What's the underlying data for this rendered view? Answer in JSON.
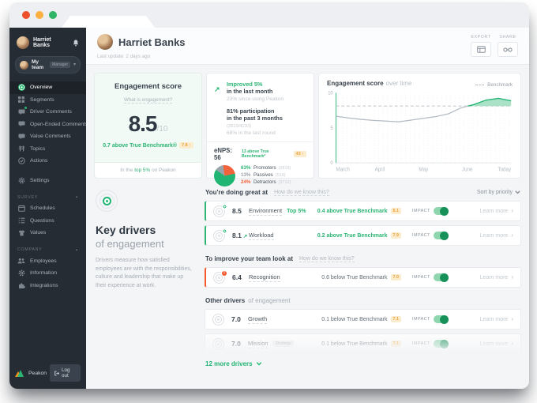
{
  "colors": {
    "accent_green": "#2bb573",
    "badge_orange_text": "#eda23c",
    "alert_orange": "#f4582a",
    "traffic_red": "#ee4d2e",
    "traffic_yellow": "#fcb042",
    "traffic_green": "#2fb567"
  },
  "icons": {
    "chevron_right": "›",
    "caret_down": "▾",
    "caret_up": "▴",
    "arrow_up_right": "↗"
  },
  "sidebar": {
    "user": {
      "name": "Harriet Banks"
    },
    "team": {
      "label": "My team",
      "badge": "Manager"
    },
    "nav": [
      {
        "label": "Overview",
        "icon": "peakon-target-icon"
      },
      {
        "label": "Segments",
        "icon": "grid-icon"
      },
      {
        "label": "Driver Comments",
        "icon": "speech-bubble-icon"
      },
      {
        "label": "Open-Ended Comments",
        "icon": "speech-bubble-icon"
      },
      {
        "label": "Value Comments",
        "icon": "speech-bubble-icon"
      },
      {
        "label": "Topics",
        "icon": "stack-icon"
      },
      {
        "label": "Actions",
        "icon": "check-circle-icon"
      }
    ],
    "settings_label": "Settings",
    "survey": {
      "label": "SURVEY",
      "items": [
        {
          "label": "Schedules"
        },
        {
          "label": "Questions"
        },
        {
          "label": "Values"
        }
      ]
    },
    "company": {
      "label": "COMPANY",
      "items": [
        {
          "label": "Employees"
        },
        {
          "label": "Information"
        },
        {
          "label": "Integrations"
        }
      ]
    },
    "brand": "Peakon",
    "logout_label": "Log out"
  },
  "header": {
    "title": "Harriet Banks",
    "last_update": "Last update: 2 days ago",
    "export_label": "EXPORT",
    "share_label": "SHARE"
  },
  "score_card": {
    "title": "Engagement score",
    "link": "What is engagement?",
    "score": "8.5",
    "out_of": "/10",
    "benchmark_line": "0.7 above True Benchmark®",
    "benchmark_badge": "7.8 ↑",
    "footer_pre": "In the",
    "footer_highlight": "top 5%",
    "footer_post": "on Peakon"
  },
  "stats": {
    "improved_title": "Improved 5%",
    "improved_sub": "in the last month",
    "improved_note": "23% since using Peakon",
    "participation_title": "81% participation",
    "participation_sub": "in the past 3 months",
    "participation_count": "(2819/4233)",
    "participation_note": "68% in the last round",
    "enps_label": "eNPS: 56",
    "enps_note": "13 above True Benchmark*",
    "enps_badge": "43 ↑",
    "legend": [
      {
        "pct": "63%",
        "name": "Promoters",
        "count": "(2819)"
      },
      {
        "pct": "13%",
        "name": "Passives",
        "count": "(519)"
      },
      {
        "pct": "24%",
        "name": "Detractors",
        "count": "(3712)"
      }
    ]
  },
  "trend_card": {
    "title": "Engagement score",
    "subtitle": "over time",
    "legend": "Benchmark"
  },
  "chart_data": [
    {
      "type": "line",
      "title": "Engagement score over time",
      "x_labels": [
        "March",
        "April",
        "May",
        "June",
        "Today"
      ],
      "x_label_positions": [
        0,
        3.5,
        7,
        10.5,
        14
      ],
      "values": [
        6.65,
        6.4,
        6.2,
        6.05,
        5.95,
        5.85,
        6.1,
        6.35,
        6.6,
        7.0,
        7.85,
        8.3,
        8.95,
        9.2,
        8.85
      ],
      "benchmark": 8.1,
      "benchmark_label": "Benchmark",
      "ylim": [
        0,
        10
      ],
      "yticks": [
        0,
        5,
        10
      ],
      "legend_position": "top-right",
      "grid": "vertical-dotted"
    },
    {
      "type": "pie",
      "labels": [
        "Promoters",
        "Passives",
        "Detractors"
      ],
      "values": [
        63,
        13,
        24
      ],
      "colors": [
        "#21b573",
        "#9aa2ab",
        "#f2633c"
      ],
      "start_angle": 78
    }
  ],
  "drivers": {
    "heading_line1": "Key drivers",
    "heading_line2": "of engagement",
    "description": "Drivers measure how satisfied employees are with the responsibilities, culture and leadership that make up their experience at work.",
    "sort_label": "Sort by priority",
    "sections": [
      {
        "title": "You're doing great at",
        "link": "How do we know this?"
      },
      {
        "title": "To improve your team look at",
        "link": "How do we know this?"
      },
      {
        "title": "Other drivers",
        "title_suffix": "of engagement"
      }
    ],
    "rows": [
      {
        "score": "8.5",
        "name": "Environment",
        "tag": "Top 5%",
        "note": "0.4 above True Benchmark",
        "badge": "8.1",
        "impact_label": "IMPACT",
        "more_label": "Learn more"
      },
      {
        "score": "8.1",
        "trend": "↗",
        "name": "Workload",
        "note": "0.2 above True Benchmark",
        "badge": "7.9",
        "impact_label": "IMPACT",
        "more_label": "Learn more"
      },
      {
        "score": "6.4",
        "name": "Recognition",
        "note": "0.6 below True Benchmark",
        "badge": "7.0",
        "impact_label": "IMPACT",
        "more_label": "Learn more"
      },
      {
        "score": "7.0",
        "name": "Growth",
        "note": "0.1 below True Benchmark",
        "badge": "7.1",
        "impact_label": "IMPACT",
        "more_label": "Learn more"
      },
      {
        "score": "7.0",
        "name": "Mission",
        "chip": "Strategy",
        "note": "0.1 below True Benchmark",
        "badge": "7.1",
        "impact_label": "IMPACT",
        "more_label": "Learn more"
      }
    ],
    "more_link": "12 more drivers"
  }
}
